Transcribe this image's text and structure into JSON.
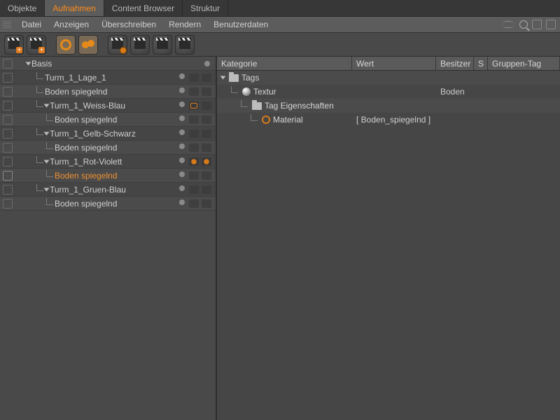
{
  "tabs": [
    "Objekte",
    "Aufnahmen",
    "Content Browser",
    "Struktur"
  ],
  "active_tab": 1,
  "menu": [
    "Datei",
    "Anzeigen",
    "Überschreiben",
    "Rendern",
    "Benutzerdaten"
  ],
  "toolbar": [
    {
      "name": "clap-plus"
    },
    {
      "name": "clap-plus-2"
    },
    {
      "name": "ring",
      "on": true
    },
    {
      "name": "blobs",
      "on": true
    },
    {
      "name": "clap-gear"
    },
    {
      "name": "clap-a"
    },
    {
      "name": "clap-b"
    },
    {
      "name": "clap-c"
    }
  ],
  "tree": [
    {
      "level": 0,
      "label": "Basis",
      "expand": true,
      "vis": "dot",
      "icons": [
        "dot"
      ]
    },
    {
      "level": 1,
      "label": "Turm_1_Lage_1",
      "vis": "dot",
      "icons": [
        "dot",
        "m",
        "m"
      ]
    },
    {
      "level": 1,
      "label": "Boden spiegelnd",
      "vis": "dot",
      "icons": [
        "dot",
        "m",
        "m"
      ]
    },
    {
      "level": 1,
      "label": "Turm_1_Weiss-Blau",
      "expand": true,
      "vis": "dot",
      "icons": [
        "dot",
        "cam",
        "m"
      ]
    },
    {
      "level": 2,
      "label": "Boden spiegelnd",
      "vis": "dot",
      "icons": [
        "dot",
        "m",
        "m"
      ]
    },
    {
      "level": 1,
      "label": "Turm_1_Gelb-Schwarz",
      "expand": true,
      "vis": "dot",
      "icons": [
        "dot",
        "m",
        "m"
      ]
    },
    {
      "level": 2,
      "label": "Boden spiegelnd",
      "vis": "dot",
      "icons": [
        "dot",
        "m",
        "m"
      ]
    },
    {
      "level": 1,
      "label": "Turm_1_Rot-Violett",
      "expand": true,
      "vis": "dot",
      "icons": [
        "dot",
        "gear",
        "gear"
      ]
    },
    {
      "level": 2,
      "label": "Boden spiegelnd",
      "vis": "full",
      "selected": true,
      "icons": [
        "dot",
        "m",
        "m"
      ]
    },
    {
      "level": 1,
      "label": "Turm_1_Gruen-Blau",
      "expand": true,
      "vis": "dot",
      "icons": [
        "dot",
        "m",
        "m"
      ]
    },
    {
      "level": 2,
      "label": "Boden spiegelnd",
      "vis": "dot",
      "icons": [
        "dot",
        "m",
        "m"
      ]
    }
  ],
  "columns": {
    "cat": "Kategorie",
    "wert": "Wert",
    "bes": "Besitzer",
    "s": "S",
    "grp": "Gruppen-Tag"
  },
  "rows": [
    {
      "indent": 0,
      "icon": "folder",
      "label": "Tags",
      "wert": "",
      "bes": ""
    },
    {
      "indent": 1,
      "icon": "sphere",
      "label": "Textur",
      "wert": "",
      "bes": "Boden"
    },
    {
      "indent": 2,
      "icon": "folder",
      "label": "Tag Eigenschaften",
      "wert": "",
      "bes": ""
    },
    {
      "indent": 3,
      "icon": "mat",
      "label": "Material",
      "wert": "[ Boden_spiegelnd ]",
      "bes": ""
    }
  ]
}
